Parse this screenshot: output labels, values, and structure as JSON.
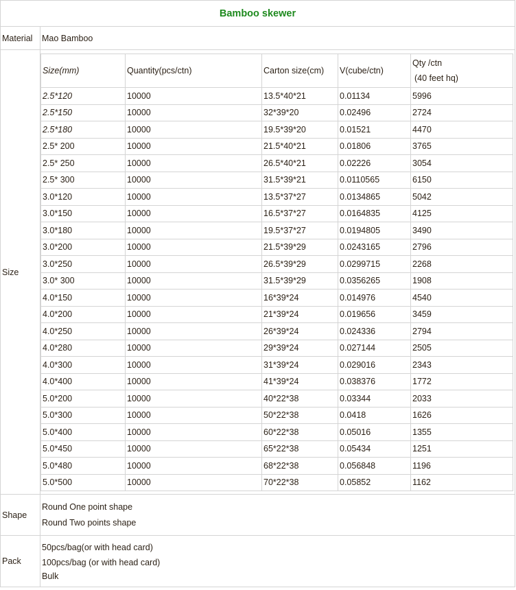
{
  "title": "Bamboo skewer",
  "material": {
    "label": "Material",
    "value": "Mao Bamboo"
  },
  "size": {
    "label": "Size",
    "headers": [
      "Size(mm)",
      "Quantity(pcs/ctn)",
      "Carton size(cm)",
      "V(cube/ctn)",
      "Qty /ctn",
      "(40 feet hq)"
    ],
    "rows": [
      [
        "2.5*120",
        "10000",
        "13.5*40*21",
        "0.01134",
        "5996"
      ],
      [
        "2.5*150",
        "10000",
        "32*39*20",
        "0.02496",
        "2724"
      ],
      [
        "2.5*180",
        "10000",
        "19.5*39*20",
        "0.01521",
        "4470"
      ],
      [
        "2.5* 200",
        "10000",
        "21.5*40*21",
        "0.01806",
        "3765"
      ],
      [
        "2.5* 250",
        "10000",
        "26.5*40*21",
        "0.02226",
        "3054"
      ],
      [
        "2.5* 300",
        "10000",
        "31.5*39*21",
        "0.0110565",
        "6150"
      ],
      [
        "3.0*120",
        "10000",
        "13.5*37*27",
        "0.0134865",
        "5042"
      ],
      [
        "3.0*150",
        "10000",
        "16.5*37*27",
        "0.0164835",
        "4125"
      ],
      [
        "3.0*180",
        "10000",
        "19.5*37*27",
        "0.0194805",
        "3490"
      ],
      [
        "3.0*200",
        "10000",
        "21.5*39*29",
        "0.0243165",
        "2796"
      ],
      [
        "3.0*250",
        "10000",
        "26.5*39*29",
        "0.0299715",
        "2268"
      ],
      [
        "3.0* 300",
        "10000",
        "31.5*39*29",
        "0.0356265",
        "1908"
      ],
      [
        "4.0*150",
        "10000",
        "16*39*24",
        "0.014976",
        "4540"
      ],
      [
        "4.0*200",
        "10000",
        "21*39*24",
        "0.019656",
        "3459"
      ],
      [
        "4.0*250",
        "10000",
        "26*39*24",
        "0.024336",
        "2794"
      ],
      [
        "4.0*280",
        "10000",
        "29*39*24",
        "0.027144",
        "2505"
      ],
      [
        "4.0*300",
        "10000",
        "31*39*24",
        "0.029016",
        "2343"
      ],
      [
        "4.0*400",
        "10000",
        "41*39*24",
        "0.038376",
        "1772"
      ],
      [
        "5.0*200",
        "10000",
        "40*22*38",
        "0.03344",
        "2033"
      ],
      [
        "5.0*300",
        "10000",
        "50*22*38",
        "0.0418",
        "1626"
      ],
      [
        "5.0*400",
        "10000",
        "60*22*38",
        "0.05016",
        "1355"
      ],
      [
        "5.0*450",
        "10000",
        "65*22*38",
        "0.05434",
        "1251"
      ],
      [
        "5.0*480",
        "10000",
        "68*22*38",
        "0.056848",
        "1196"
      ],
      [
        "5.0*500",
        "10000",
        "70*22*38",
        "0.05852",
        "1162"
      ]
    ]
  },
  "shape": {
    "label": "Shape",
    "lines": [
      "Round One point shape",
      "Round Two points shape"
    ]
  },
  "pack": {
    "label": "Pack",
    "lines": [
      "50pcs/bag(or with head card)",
      "100pcs/bag (or with head card)",
      "Bulk"
    ]
  },
  "colors": {
    "title": "#1e8a1e",
    "border": "#d4d4d4"
  }
}
